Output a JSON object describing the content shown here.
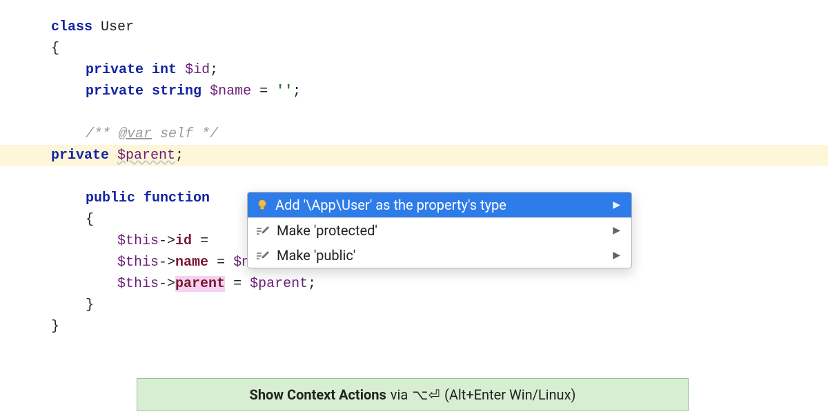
{
  "code": {
    "kw_class": "class",
    "class_name": "User",
    "open_brace": "{",
    "close_brace": "}",
    "kw_private": "private",
    "kw_public": "public",
    "kw_int": "int",
    "kw_string": "string",
    "kw_function": "function",
    "var_id": "$id",
    "var_name": "$name",
    "var_parent": "$parent",
    "empty_str": "''",
    "doc_open": "/** ",
    "doc_tag": "@var",
    "doc_type": " self ",
    "doc_close": "*/",
    "this_prefix": "$this",
    "arrow": "->",
    "memb_id": "id",
    "memb_name": "name",
    "memb_parent": "parent",
    "assign_name_rhs": "$name",
    "assign_parent_rhs": "$parent",
    "semi": ";",
    "eq": "=",
    "eq_hidden": "=",
    "sp": " "
  },
  "popup": {
    "items": [
      {
        "label": "Add '\\App\\User' as the property's type",
        "icon": "lightbulb-icon",
        "selected": true
      },
      {
        "label": "Make 'protected'",
        "icon": "pencil-icon",
        "selected": false
      },
      {
        "label": "Make 'public'",
        "icon": "pencil-icon",
        "selected": false
      }
    ]
  },
  "hint": {
    "strong": "Show Context Actions",
    "via": " via ",
    "shortcut_mac": "⌥⏎",
    "rest": " (Alt+Enter Win/Linux)"
  }
}
